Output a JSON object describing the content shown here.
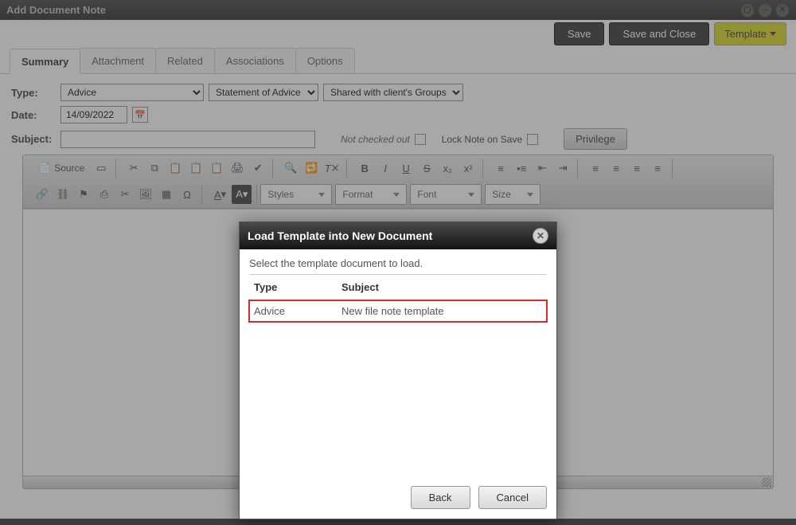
{
  "window": {
    "title": "Add Document Note"
  },
  "topbar": {
    "save": "Save",
    "save_close": "Save and Close",
    "template": "Template"
  },
  "tabs": {
    "summary": "Summary",
    "attachment": "Attachment",
    "related": "Related",
    "associations": "Associations",
    "options": "Options"
  },
  "form": {
    "type_label": "Type:",
    "type_value": "Advice",
    "type_opt2": "Statement of Advice",
    "type_opt3": "Shared with client's Groups",
    "date_label": "Date:",
    "date_value": "14/09/2022",
    "subject_label": "Subject:",
    "subject_value": "",
    "not_checked_out": "Not checked out",
    "lock_label": "Lock Note on Save",
    "privilege": "Privilege"
  },
  "editor": {
    "source": "Source",
    "styles": "Styles",
    "format": "Format",
    "font": "Font",
    "size": "Size"
  },
  "modal": {
    "title": "Load Template into New Document",
    "instruction": "Select the template document to load.",
    "col_type": "Type",
    "col_subject": "Subject",
    "row_type": "Advice",
    "row_subject": "New file note template",
    "back": "Back",
    "cancel": "Cancel"
  }
}
